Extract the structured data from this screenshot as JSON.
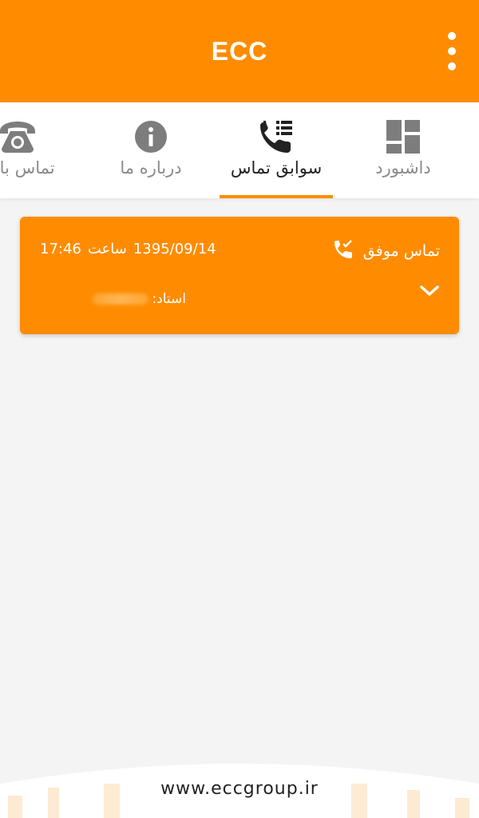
{
  "app": {
    "title": "ECC"
  },
  "tabs": [
    {
      "label": "داشبورد",
      "icon": "dashboard-icon",
      "active": false
    },
    {
      "label": "سوابق تماس",
      "icon": "call-history-icon",
      "active": true
    },
    {
      "label": "درباره ما",
      "icon": "info-icon",
      "active": false
    },
    {
      "label": "تماس با ما",
      "icon": "phone-icon",
      "active": false
    }
  ],
  "call_log": [
    {
      "status": "تماس موفق",
      "date": "1395/09/14",
      "time_label": "ساعت",
      "time": "17:46",
      "teacher_label": "استاد:"
    }
  ],
  "footer": {
    "url": "www.eccgroup.ir"
  },
  "colors": {
    "accent": "#ff8c00",
    "background": "#f4f4f4"
  }
}
